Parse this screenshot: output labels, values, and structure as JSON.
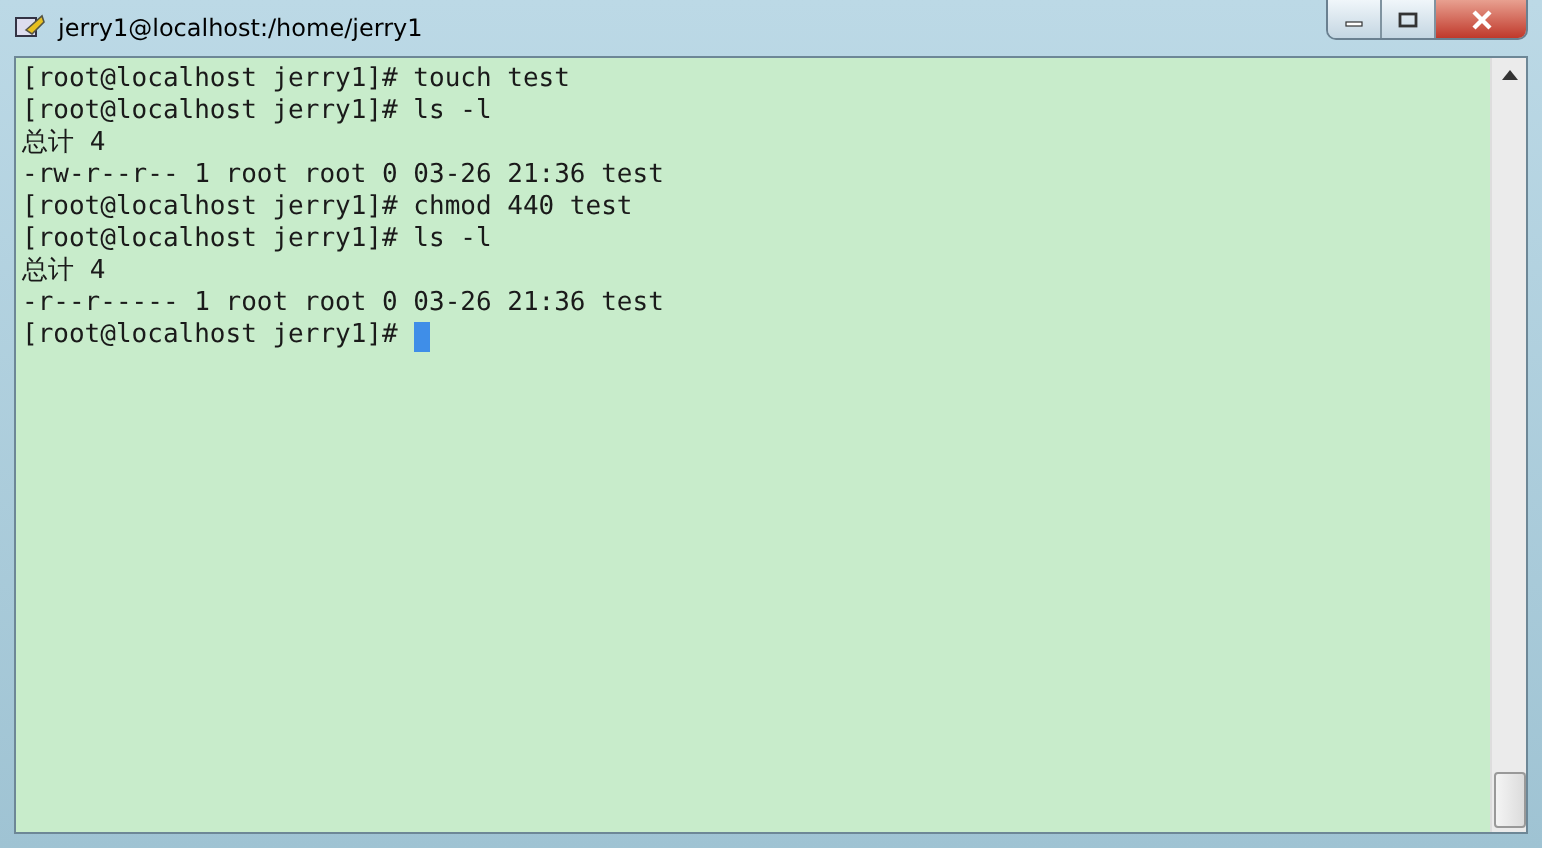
{
  "window": {
    "title": "jerry1@localhost:/home/jerry1"
  },
  "terminal": {
    "lines": [
      "[root@localhost jerry1]# touch test",
      "[root@localhost jerry1]# ls -l",
      "总计 4",
      "-rw-r--r-- 1 root root 0 03-26 21:36 test",
      "[root@localhost jerry1]# chmod 440 test",
      "[root@localhost jerry1]# ls -l",
      "总计 4",
      "-r--r----- 1 root root 0 03-26 21:36 test",
      "[root@localhost jerry1]# "
    ],
    "cursor": true
  }
}
